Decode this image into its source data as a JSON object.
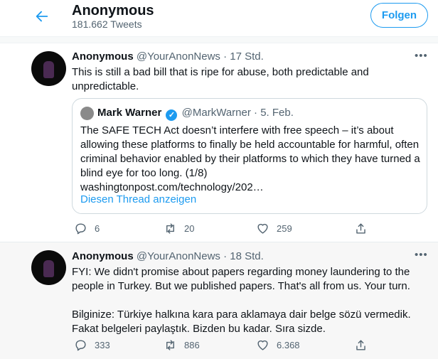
{
  "header": {
    "title": "Anonymous",
    "tweet_count": "181.662 Tweets",
    "follow_label": "Folgen"
  },
  "tweets": [
    {
      "name": "Anonymous",
      "handle": "@YourAnonNews",
      "separator": "·",
      "time": "17 Std.",
      "text": "This is still a bad bill that is ripe for abuse, both predictable and unpredictable.",
      "quote": {
        "name": "Mark Warner",
        "handle": "@MarkWarner",
        "separator": "·",
        "time": "5. Feb.",
        "text": "The SAFE TECH Act doesn’t interfere with free speech – it’s about allowing these platforms to finally be held accountable for harmful, often criminal behavior enabled by their platforms to which they have turned a blind eye for too long. (1/8)",
        "link": "washingtonpost.com/technology/202…",
        "thread_link": "Diesen Thread anzeigen"
      },
      "replies": "6",
      "retweets": "20",
      "likes": "259"
    },
    {
      "name": "Anonymous",
      "handle": "@YourAnonNews",
      "separator": "·",
      "time": "18 Std.",
      "text_1": "FYI: We didn't promise about papers regarding money laundering to the people in Turkey. But we published papers. That's all from us. Your turn.",
      "text_2": "Bilginize: Türkiye halkına kara para aklamaya dair belge sözü vermedik. Fakat belgeleri paylaştık. Bizden bu kadar. Sıra sizde.",
      "replies": "333",
      "retweets": "886",
      "likes": "6.368"
    }
  ],
  "icons": {
    "back": "arrow-left-icon",
    "more": "more-icon",
    "verified": "verified-badge-icon",
    "reply": "reply-icon",
    "retweet": "retweet-icon",
    "like": "heart-icon",
    "share": "share-icon"
  },
  "colors": {
    "accent": "#1d9bf0",
    "text": "#0f1419",
    "muted": "#536471"
  }
}
